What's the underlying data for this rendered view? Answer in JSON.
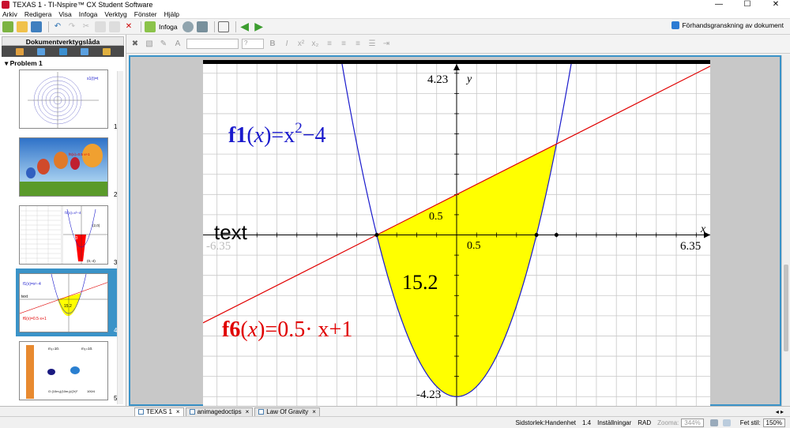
{
  "window": {
    "title": "TEXAS 1 - TI-Nspire™ CX Student Software"
  },
  "menu": [
    "Arkiv",
    "Redigera",
    "Visa",
    "Infoga",
    "Verktyg",
    "Fönster",
    "Hjälp"
  ],
  "toolbar": {
    "insert_label": "Infoga",
    "preview_label": "Förhandsgranskning av dokument"
  },
  "format": {
    "font_size": "?"
  },
  "sidebar": {
    "title": "Dokumentverktygslåda",
    "problem": "Problem 1",
    "pages": [
      {
        "num": "1"
      },
      {
        "num": "2"
      },
      {
        "num": "3"
      },
      {
        "num": "4"
      },
      {
        "num": "5"
      }
    ],
    "thumb1_label": "s1(t)=t",
    "thumb2_label": "f6(x)=0.5·x+1",
    "thumb3_fn": "f1(x)=x²−4",
    "thumb3_pt1": "(2,0)",
    "thumb3_pt2": "(0,-4)",
    "thumb3_area": "-5.33",
    "thumb4_f1": "f1(x)=x²−4",
    "thumb4_text": "text",
    "thumb4_area": "15.2",
    "thumb4_f6": "f6(x)=0.5·x+1",
    "thumb5_m1": "m₁=10.",
    "thumb5_m2": "m₂=10.",
    "thumb5_formula": "G·(10m₁)(10m₂)/(2r)²",
    "thumb5_frac": "100/4"
  },
  "graph": {
    "y_max_label": "4.23",
    "y_min_label": "-4.23",
    "x_max_label": "6.35",
    "x_min_label": "-6.35",
    "x_axis": "x",
    "y_axis": "y",
    "y_tick": "0.5",
    "x_tick": "0.5",
    "f1_name": "f1",
    "f1_x": "x",
    "f1_rhs": "=x",
    "f1_exp": "2",
    "f1_tail": "−4",
    "f6_name": "f6",
    "f6_x": "x",
    "f6_rhs": "=0.5· x+1",
    "text_label": "text",
    "area_label": "15.2",
    "colors": {
      "f1": "#1a1acc",
      "f6": "#e00000",
      "fill": "#ffff00"
    }
  },
  "tabs": [
    {
      "label": "TEXAS 1",
      "close": "×"
    },
    {
      "label": "animagedoctips",
      "close": "×"
    },
    {
      "label": "Law Of Gravity",
      "close": "×"
    }
  ],
  "status": {
    "page_size": "Sidstorlek:Handenhet",
    "version": "1.4",
    "settings": "Inställningar",
    "mode": "RAD",
    "zoom_label": "Zooma:",
    "zoom_value": "344%",
    "font_size_label": "Fet stil:",
    "font_size_value": "150%"
  }
}
